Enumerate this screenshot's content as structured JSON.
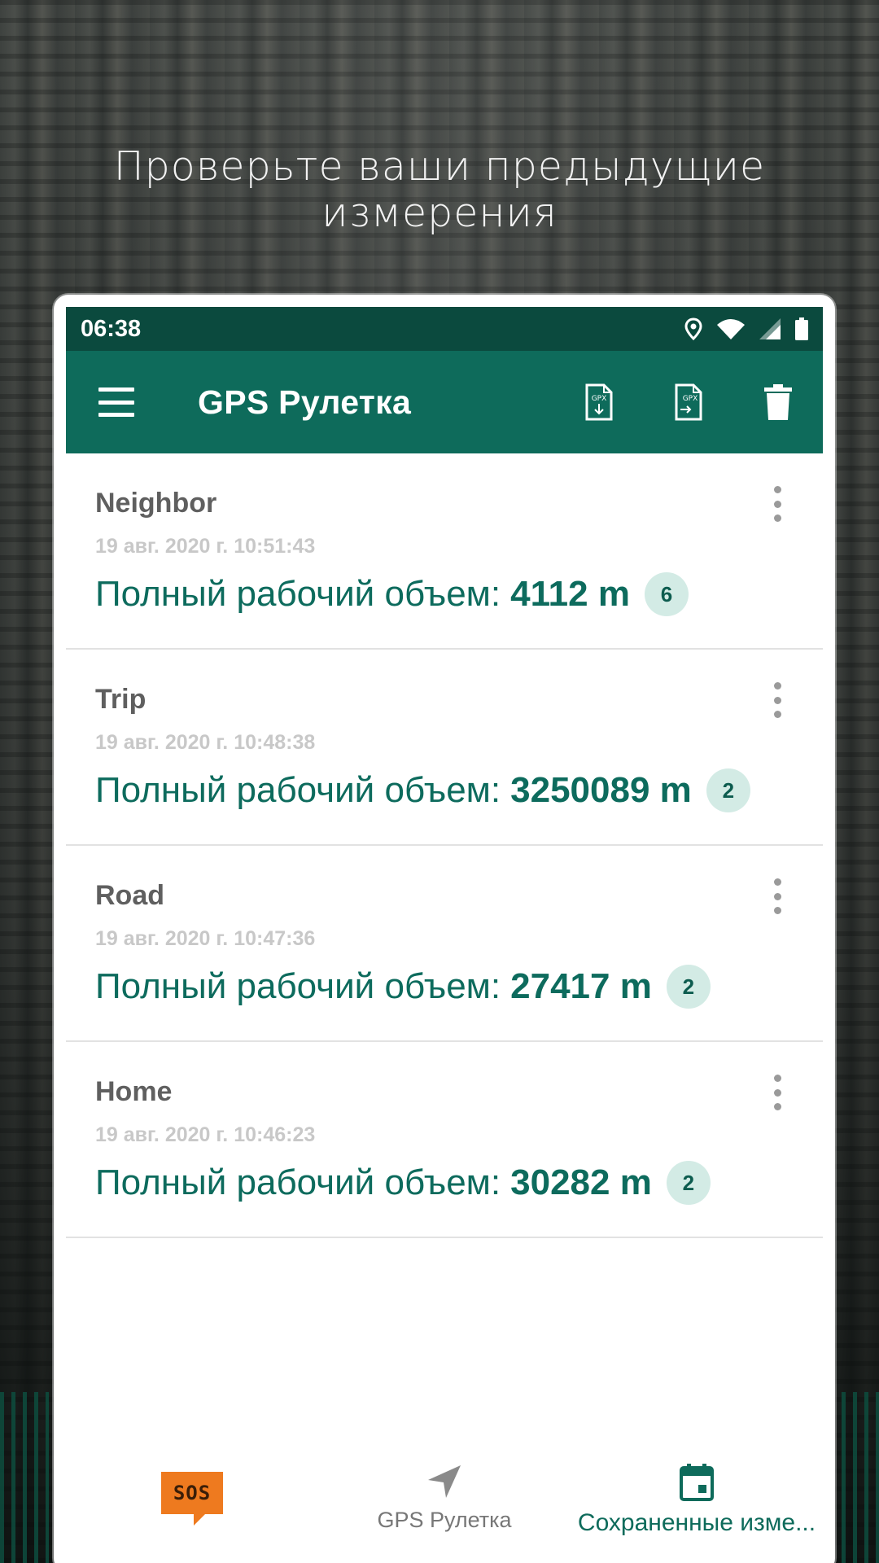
{
  "headline": "Проверьте ваши предыдущие измерения",
  "statusbar": {
    "time": "06:38"
  },
  "appbar": {
    "title": "GPS Рулетка",
    "actions": [
      "export-gpx-icon",
      "import-gpx-icon",
      "trash-icon"
    ]
  },
  "measurements": [
    {
      "name": "Neighbor",
      "date": "19 авг. 2020 г. 10:51:43",
      "label": "Полный рабочий объем:",
      "value": "4112 m",
      "count": "6"
    },
    {
      "name": "Trip",
      "date": "19 авг. 2020 г. 10:48:38",
      "label": "Полный рабочий объем:",
      "value": "3250089 m",
      "count": "2"
    },
    {
      "name": "Road",
      "date": "19 авг. 2020 г. 10:47:36",
      "label": "Полный рабочий объем:",
      "value": "27417 m",
      "count": "2"
    },
    {
      "name": "Home",
      "date": "19 авг. 2020 г. 10:46:23",
      "label": "Полный рабочий объем:",
      "value": "30282 m",
      "count": "2"
    }
  ],
  "bottomnav": {
    "sos_label": "SOS",
    "items": [
      {
        "label": ""
      },
      {
        "label": "GPS Рулетка"
      },
      {
        "label": "Сохраненные изме..."
      }
    ]
  },
  "colors": {
    "primary": "#0e6b5b",
    "statusbar": "#0b4a3e",
    "accent": "#ee7a1f",
    "badge": "#d3ebe5"
  }
}
